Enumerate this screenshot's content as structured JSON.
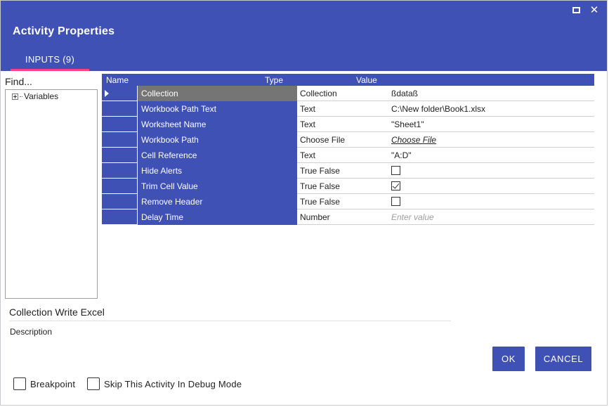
{
  "window": {
    "title": "Activity Properties",
    "tab": "INPUTS (9)",
    "close_glyph": "✕"
  },
  "colors": {
    "primary": "#3f51b5",
    "tab_indicator": "#ff4081",
    "selected_row": "#757575"
  },
  "find": {
    "placeholder": "Find..."
  },
  "tree": {
    "items": [
      {
        "label": "Variables",
        "icon": "expand-plus-icon"
      }
    ]
  },
  "grid": {
    "headers": {
      "name": "Name",
      "type": "Type",
      "value": "Value"
    },
    "rows": [
      {
        "name": "Collection",
        "type": "Collection",
        "value": "ßdataß",
        "kind": "text",
        "selected": true
      },
      {
        "name": "Workbook Path Text",
        "type": "Text",
        "value": "C:\\New folder\\Book1.xlsx",
        "kind": "text"
      },
      {
        "name": "Worksheet Name",
        "type": "Text",
        "value": "\"Sheet1\"",
        "kind": "text"
      },
      {
        "name": "Workbook Path",
        "type": "Choose File",
        "value": "Choose File",
        "kind": "link"
      },
      {
        "name": "Cell Reference",
        "type": "Text",
        "value": "\"A:D\"",
        "kind": "text"
      },
      {
        "name": "Hide Alerts",
        "type": "True False",
        "checked": false,
        "kind": "checkbox"
      },
      {
        "name": "Trim Cell Value",
        "type": "True False",
        "checked": true,
        "kind": "checkbox"
      },
      {
        "name": "Remove Header",
        "type": "True False",
        "checked": false,
        "kind": "checkbox"
      },
      {
        "name": "Delay Time",
        "type": "Number",
        "placeholder": "Enter value",
        "kind": "placeholder"
      }
    ]
  },
  "activity": {
    "name": "Collection Write Excel",
    "description_label": "Description"
  },
  "buttons": {
    "ok": "OK",
    "cancel": "CANCEL"
  },
  "options": {
    "breakpoint": "Breakpoint",
    "skip_debug": "Skip This Activity In Debug Mode"
  }
}
